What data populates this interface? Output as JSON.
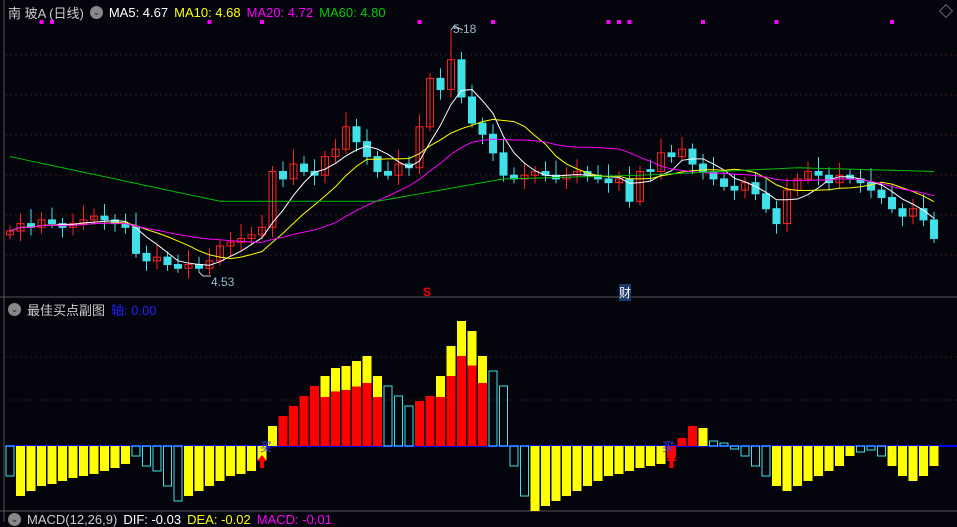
{
  "header": {
    "title": "南 玻A (日线)",
    "ma5": "MA5: 4.67",
    "ma10": "MA10: 4.68",
    "ma20": "MA20: 4.72",
    "ma60": "MA60: 4.80"
  },
  "sub": {
    "title": "最佳买点副图",
    "axis": "轴: 0.00",
    "buy_label": "买"
  },
  "macd_header": {
    "title": "MACD(12,26,9)",
    "dif": "DIF: -0.03",
    "dea": "DEA: -0.02",
    "macd": "MACD: -0.01"
  },
  "annotations": {
    "high": "5.18",
    "low": "4.53",
    "s_marker": "S",
    "cai_marker": "财"
  },
  "colors": {
    "up": "#ff2020",
    "down": "#40e0e8",
    "ma5": "#ffffff",
    "ma10": "#ffff00",
    "ma20": "#ff00ff",
    "ma60": "#00c000",
    "zero": "#0000ff",
    "bar_red": "#ff0000",
    "bar_yellow": "#ffff00"
  },
  "chart_data": [
    {
      "type": "candlestick",
      "title": "南 玻A (日线)",
      "ylim": [
        4.5,
        5.22
      ],
      "closes": [
        4.64,
        4.66,
        4.65,
        4.67,
        4.66,
        4.65,
        4.66,
        4.67,
        4.68,
        4.67,
        4.66,
        4.65,
        4.58,
        4.56,
        4.57,
        4.55,
        4.54,
        4.55,
        4.54,
        4.56,
        4.6,
        4.61,
        4.62,
        4.63,
        4.65,
        4.8,
        4.78,
        4.82,
        4.8,
        4.79,
        4.84,
        4.86,
        4.92,
        4.88,
        4.84,
        4.8,
        4.79,
        4.82,
        4.81,
        4.92,
        5.05,
        5.02,
        5.1,
        5.0,
        4.93,
        4.9,
        4.85,
        4.79,
        4.78,
        4.79,
        4.8,
        4.79,
        4.78,
        4.79,
        4.8,
        4.79,
        4.78,
        4.77,
        4.78,
        4.72,
        4.8,
        4.8,
        4.85,
        4.84,
        4.86,
        4.82,
        4.8,
        4.78,
        4.76,
        4.75,
        4.77,
        4.74,
        4.7,
        4.66,
        4.75,
        4.78,
        4.8,
        4.79,
        4.77,
        4.79,
        4.78,
        4.77,
        4.75,
        4.73,
        4.7,
        4.68,
        4.7,
        4.67,
        4.62
      ],
      "ma60_keypoints": [
        [
          0,
          4.84
        ],
        [
          20,
          4.72
        ],
        [
          35,
          4.72
        ],
        [
          47,
          4.78
        ],
        [
          60,
          4.79
        ],
        [
          75,
          4.81
        ],
        [
          88,
          4.8
        ]
      ],
      "high_point": {
        "index": 42,
        "value": 5.18
      },
      "low_point": {
        "index": 18,
        "value": 4.53
      },
      "event_markers": [
        3,
        4,
        19,
        24,
        39,
        46,
        57,
        58,
        59,
        66,
        73,
        84
      ]
    },
    {
      "type": "bar",
      "title": "最佳买点副图",
      "ylim": [
        -0.07,
        0.13
      ],
      "values": [
        -0.03,
        -0.05,
        -0.045,
        -0.04,
        -0.038,
        -0.035,
        -0.032,
        -0.03,
        -0.028,
        -0.025,
        -0.022,
        -0.018,
        -0.01,
        -0.02,
        -0.025,
        -0.04,
        -0.055,
        -0.05,
        -0.045,
        -0.04,
        -0.035,
        -0.03,
        -0.028,
        -0.025,
        -0.015,
        0.02,
        0.03,
        0.04,
        0.05,
        0.06,
        0.07,
        0.078,
        0.08,
        0.085,
        0.09,
        0.07,
        0.06,
        0.05,
        0.04,
        0.045,
        0.05,
        0.07,
        0.1,
        0.125,
        0.115,
        0.09,
        0.075,
        0.06,
        -0.02,
        -0.05,
        -0.065,
        -0.06,
        -0.055,
        -0.05,
        -0.045,
        -0.04,
        -0.035,
        -0.03,
        -0.028,
        -0.025,
        -0.022,
        -0.02,
        -0.018,
        -0.012,
        0.008,
        0.02,
        0.018,
        0.005,
        0.003,
        -0.003,
        -0.01,
        -0.02,
        -0.03,
        -0.04,
        -0.045,
        -0.04,
        -0.035,
        -0.03,
        -0.025,
        -0.02,
        -0.01,
        -0.006,
        -0.004,
        -0.01,
        -0.02,
        -0.03,
        -0.035,
        -0.03,
        -0.02
      ],
      "kinds": "cyyyyyyyyyyycccccyyyyyyyyyrrrrrrrrrrcccrrrrrrrccccyyyyyyyyyyyyyrrryccccccyyyyyyyycccyy",
      "buy_points": [
        24,
        63
      ]
    }
  ]
}
